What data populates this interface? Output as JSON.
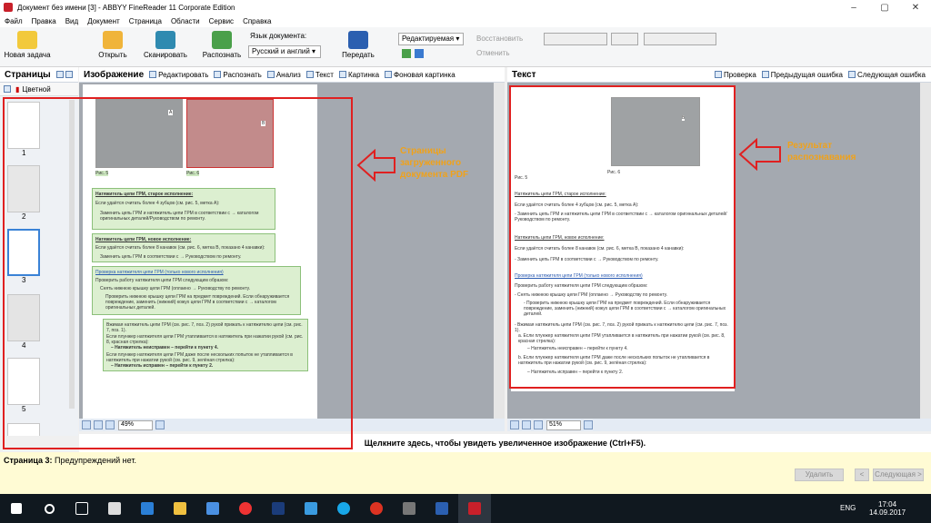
{
  "window": {
    "title": "Документ без имени [3] - ABBYY FineReader 11 Corporate Edition"
  },
  "menu": [
    "Файл",
    "Правка",
    "Вид",
    "Документ",
    "Страница",
    "Области",
    "Сервис",
    "Справка"
  ],
  "toolbar": {
    "new_task": "Новая задача",
    "open": "Открыть",
    "scan": "Сканировать",
    "recognize": "Распознать",
    "lang_label": "Язык документа:",
    "lang_value": "Русский и англий",
    "send": "Передать",
    "mode_value": "Редактируемая",
    "restore": "Восстановить",
    "cancel": "Отменить"
  },
  "pages_panel": {
    "title": "Страницы",
    "color_label": "Цветной",
    "page_numbers": [
      "1",
      "2",
      "3",
      "4",
      "5"
    ]
  },
  "image_panel": {
    "title": "Изображение",
    "tools": [
      "Редактировать",
      "Распознать",
      "Анализ",
      "Текст",
      "Картинка",
      "Фоновая картинка"
    ],
    "zoom": "49%"
  },
  "text_panel": {
    "title": "Текст",
    "tools": [
      "Проверка",
      "Предыдущая ошибка",
      "Следующая ошибка"
    ],
    "zoom": "51%"
  },
  "image_doc": {
    "fig5": "Рис. 5",
    "fig6": "Рис. 6",
    "marker_a": "A",
    "marker_b": "B",
    "h1": "Натяжитель цепи ГРМ, старое исполнение:",
    "p1": "Если удаётся считать более 4 зубцов (см. рис. 5, метка А):",
    "b1": "Заменить цепь ГРМ и натяжитель цепи ГРМ в соответствии с → каталогом оригинальных деталей/Руководством по ремонту.",
    "h2": "Натяжитель цепи ГРМ, новое исполнение:",
    "p2": "Если удаётся считать более 8 канавок (см. рис. 6, метка В, показано 4 канавки):",
    "b2": "Заменить цепь ГРМ в соответствии с → Руководством по ремонту.",
    "h3": "Проверка натяжителя цепи ГРМ (только нового исполнения)",
    "p3": "Проверить работу натяжителя цепи ГРМ следующим образом:",
    "b3": "Снять нижнюю крышку цепи ГРМ (оплаено → Руководству по ремонту.",
    "b4": "Проверить нижнюю крышку цепи ГРМ на предмет повреждений. Если обнаруживается повреждение, заменить (нижний) кожух цепи ГРМ в соответствии с → каталогом оригинальных деталей.",
    "s1": "Вжимая натяжитель цепи ГРМ (см. рис. 7, поз. 2) рукой прижать к натяжителю цепи (см. рис. 7, поз. 1).",
    "s2": "Если плунжер натяжителя цепи ГРМ утапливается в натяжитель при нажатии рукой (см. рис. 8, красная стрелка):",
    "s2a": "– Натяжитель неисправен – перейти к пункту 4.",
    "s3": "Если плунжер натяжителя цепи ГРМ даже после нескольких попыток не утапливается в натяжитель при нажатии рукой (см. рис. 9, зелёная стрелка):",
    "s3a": "– Натяжитель исправен – перейти к пункту 2."
  },
  "text_doc": {
    "fig5": "Рис. 5",
    "fig6": "Рис. 6",
    "marker_b": "B",
    "h1": "Натяжитель цепи ГРМ, старое исполнение:",
    "p1": "Если удаётся считать более 4 зубцов (см. рис. 5, метка А):",
    "b1": "- Заменить цепь ГРМ и натяжитель цепи ГРМ в соответствии с → каталогом оригинальных деталей/Руководством по ремонту.",
    "h2": "Натяжитель цепи ГРМ, новое исполнение:",
    "p2": "Если удаётся считать более 8 канавок (см. рис. 6, метка В, показано 4 канавки):",
    "b2": "- Заменить цепь ГРМ в соответствии с → Руководством по ремонту.",
    "h3": "Проверка натяжителя цепи ГРМ (только нового исполнения)",
    "p3": "Проверить работу натяжителя цепи ГРМ следующим образом:",
    "b3": "- Снять нижнюю крышку цепи ГРМ (оплаено → Руководству по ремонту.",
    "b4": "- Проверить нижнюю крышку цепи ГРМ на предмет повреждений. Если обнаруживается повреждение, заменить (нижний) кожух цепи ГРМ в соответствии с → каталогом оригинальных деталей.",
    "s1": "- Вжимая натяжитель цепи ГРМ (см. рис. 7, поз. 2) рукой прижать к натяжителю цепи (см. рис. 7, поз. 1).",
    "s2": "а. Если плунжер натяжителя цепи ГРМ утапливается в натяжитель при нажатии рукой (см. рис. 8, красная стрелка):",
    "s2a": "– Натяжитель неисправен – перейти к пункту 4.",
    "s3": "b. Если плунжер натяжителя цепи ГРМ даже после нескольких попыток не утапливается в натяжитель при нажатии рукой (см. рис. 9, зелёная стрелка):",
    "s3a": "– Натяжитель исправен – перейти к пункту 2."
  },
  "annotations": {
    "left": [
      "Страницы",
      "загруженного",
      "документа PDF"
    ],
    "right": [
      "Результат",
      "распознавания"
    ]
  },
  "hint": "Щелкните здесь, чтобы увидеть увеличенное изображение (Ctrl+F5).",
  "status": {
    "page_label": "Страница 3:",
    "message": "Предупреждений нет.",
    "delete": "Удалить",
    "prev": "<",
    "next": "Следующая >"
  },
  "tray": {
    "lang": "ENG",
    "time": "17:04",
    "date": "14.09.2017"
  },
  "colors": {
    "accent_red": "#e02020",
    "callout": "#f0a21a",
    "taskbar": "#10181f"
  }
}
